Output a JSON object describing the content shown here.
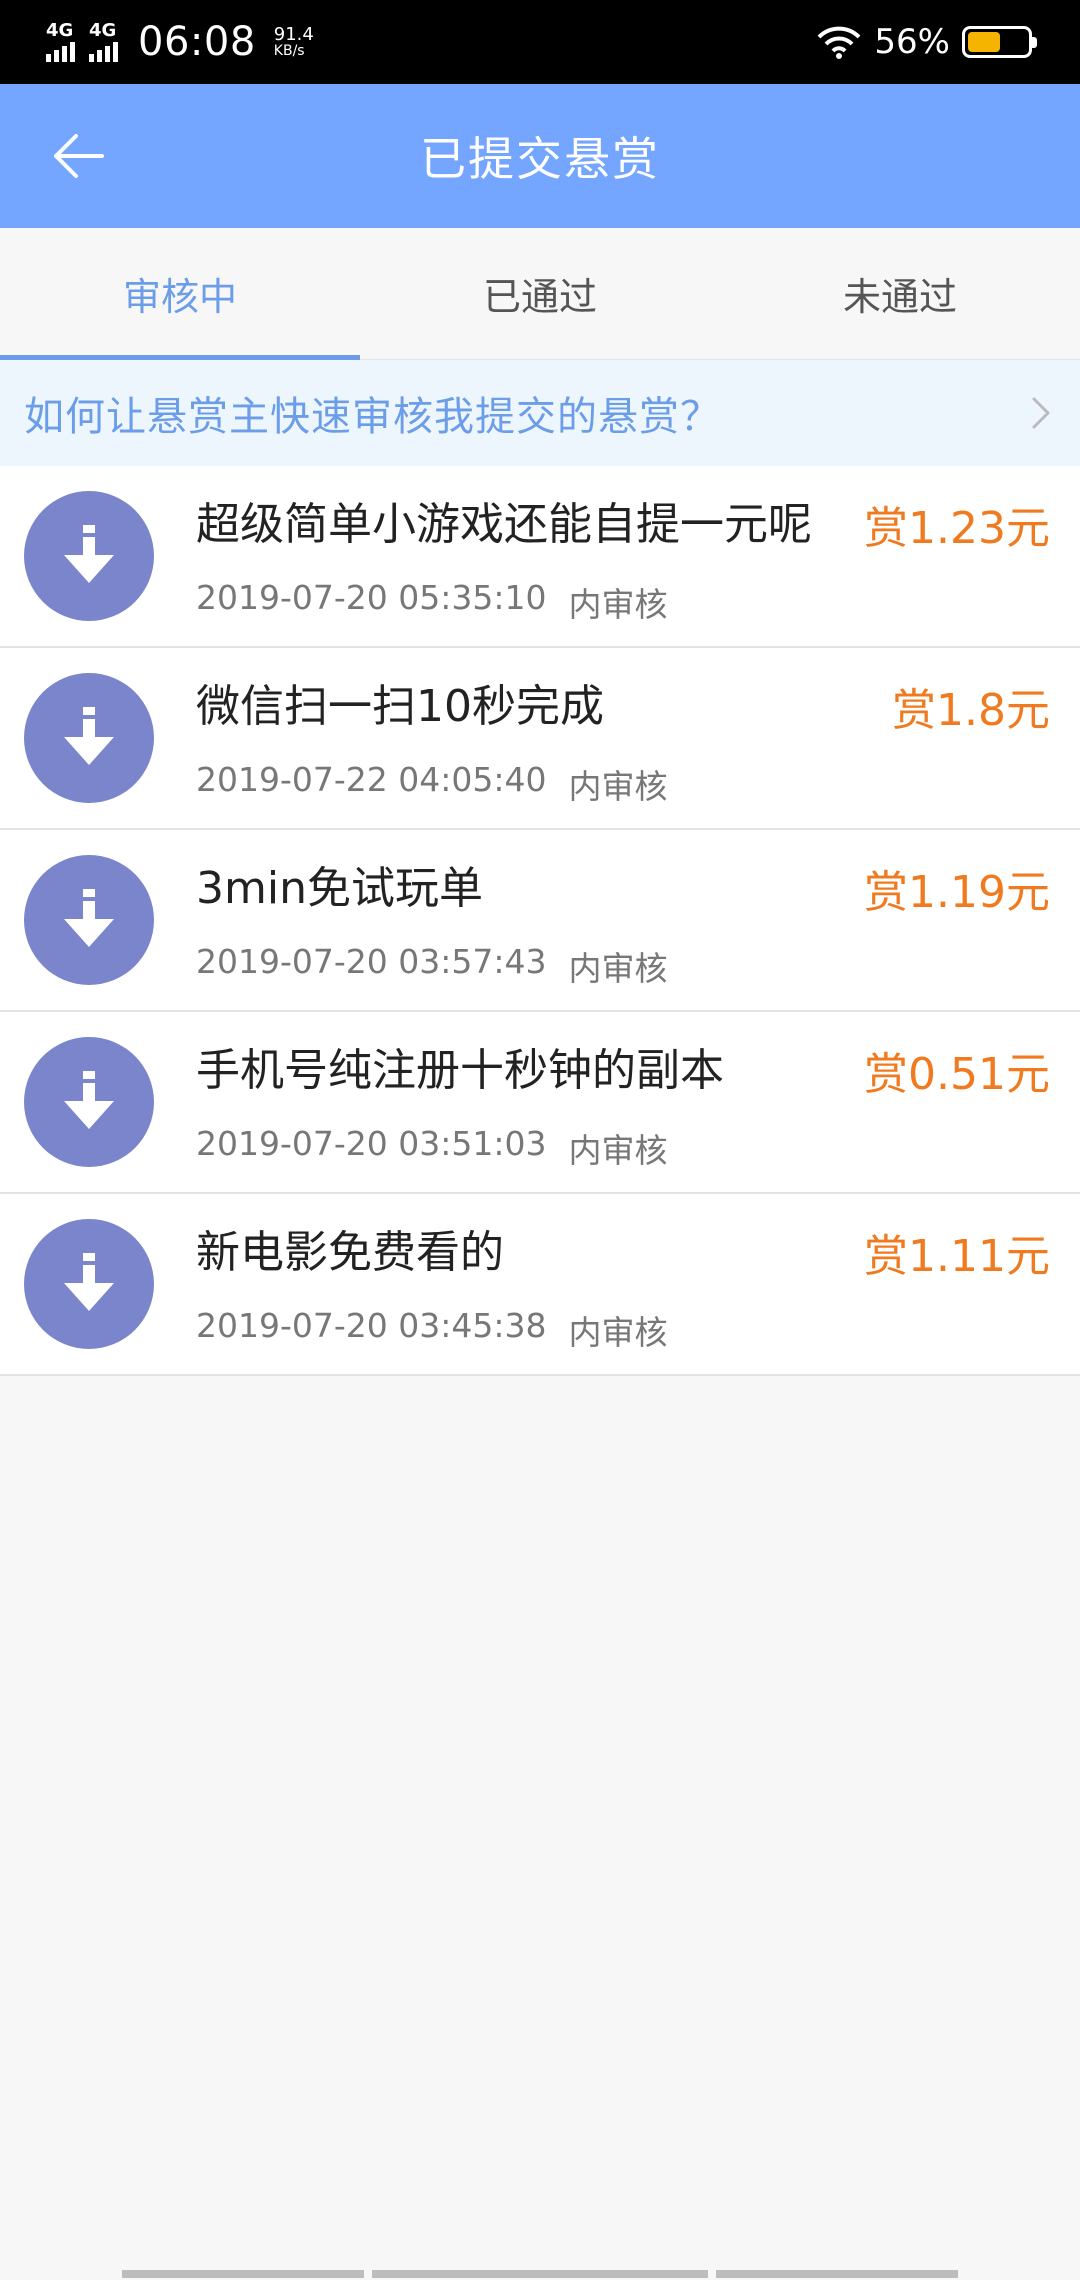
{
  "status_bar": {
    "network1": "4G",
    "network2": "4G",
    "time": "06:08",
    "speed_value": "91.4",
    "speed_unit": "KB/s",
    "battery_percent": "56%",
    "battery_level": 0.56,
    "battery_color": "#f5b400"
  },
  "header": {
    "back_icon": "arrow-left-icon",
    "title": "已提交悬赏"
  },
  "tabs": [
    {
      "label": "审核中",
      "active": true
    },
    {
      "label": "已通过",
      "active": false
    },
    {
      "label": "未通过",
      "active": false
    }
  ],
  "help_banner": {
    "text": "如何让悬赏主快速审核我提交的悬赏？",
    "icon": "chevron-right-icon"
  },
  "items": [
    {
      "title": "超级简单小游戏还能自提一元呢",
      "time": "2019-07-20 05:35:10",
      "status": "内审核",
      "reward": "赏1.23元",
      "icon": "download-icon"
    },
    {
      "title": "微信扫一扫10秒完成",
      "time": "2019-07-22 04:05:40",
      "status": "内审核",
      "reward": "赏1.8元",
      "icon": "download-icon"
    },
    {
      "title": "3min免试玩单",
      "time": "2019-07-20 03:57:43",
      "status": "内审核",
      "reward": "赏1.19元",
      "icon": "download-icon"
    },
    {
      "title": "手机号纯注册十秒钟的副本",
      "time": "2019-07-20 03:51:03",
      "status": "内审核",
      "reward": "赏0.51元",
      "icon": "download-icon"
    },
    {
      "title": "新电影免费看的",
      "time": "2019-07-20 03:45:38",
      "status": "内审核",
      "reward": "赏1.11元",
      "icon": "download-icon"
    }
  ],
  "colors": {
    "header_bg": "#74a6ff",
    "accent": "#6b9de8",
    "reward": "#f07a1f",
    "avatar_bg": "#7b85cc"
  }
}
